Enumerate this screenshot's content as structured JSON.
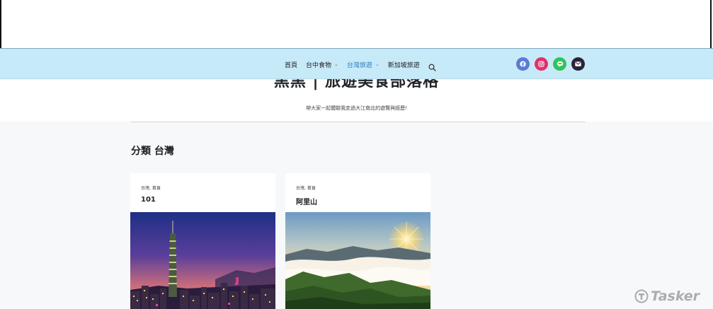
{
  "site": {
    "title": "黑黑 | 旅遊美食部落格",
    "tagline": "帶大家一起體驗我走過大江南北的遊覽與經歷!"
  },
  "nav": {
    "items": [
      {
        "label": "首頁",
        "has_dropdown": false,
        "active": false
      },
      {
        "label": "台中食物",
        "has_dropdown": true,
        "active": false
      },
      {
        "label": "台灣旅遊",
        "has_dropdown": true,
        "active": true
      },
      {
        "label": "新加坡旅遊",
        "has_dropdown": false,
        "active": false
      }
    ],
    "search_icon": "search-icon"
  },
  "socials": [
    {
      "name": "facebook-icon",
      "color": "#5b7bd5"
    },
    {
      "name": "instagram-icon",
      "color": "#e1306c"
    },
    {
      "name": "line-icon",
      "color": "#2ec55a"
    },
    {
      "name": "email-icon",
      "color": "#2a2236"
    }
  ],
  "category": {
    "title": "分類 台灣"
  },
  "posts": [
    {
      "categories": "台灣, 首頁",
      "title": "101",
      "image": "taipei-101-night-photo"
    },
    {
      "categories": "台灣, 首頁",
      "title": "阿里山",
      "image": "alishan-sunrise-sea-of-clouds-photo"
    }
  ],
  "watermark": {
    "text": "Tasker"
  },
  "colors": {
    "nav_bg": "#c7eaf9",
    "active": "#2f7fc1",
    "page_bg": "#f7f8fa"
  }
}
